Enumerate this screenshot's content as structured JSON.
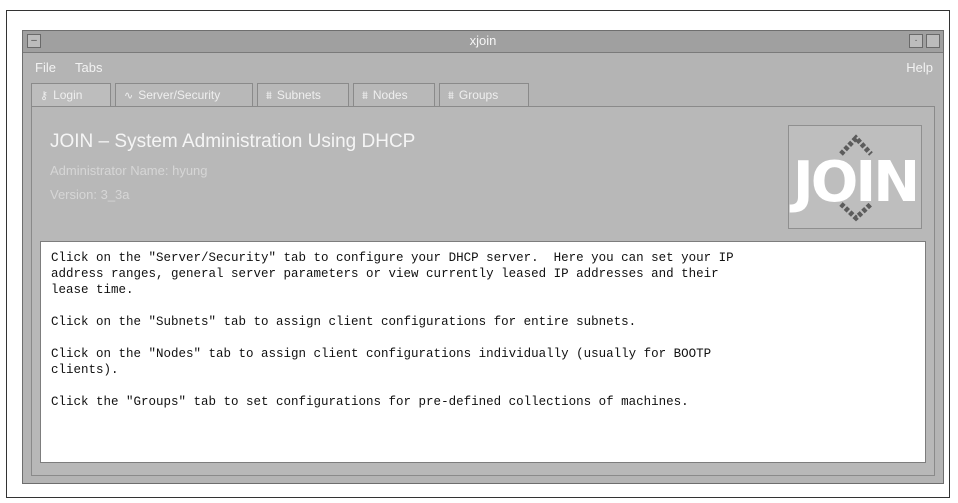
{
  "window": {
    "title": "xjoin"
  },
  "menubar": {
    "file": "File",
    "tabs": "Tabs",
    "help": "Help"
  },
  "tabs": [
    {
      "label": "Login",
      "icon": "keyhole-icon"
    },
    {
      "label": "Server/Security",
      "icon": "wave-icon"
    },
    {
      "label": "Subnets",
      "icon": "network-icon"
    },
    {
      "label": "Nodes",
      "icon": "network-icon"
    },
    {
      "label": "Groups",
      "icon": "network-icon"
    }
  ],
  "header": {
    "title": "JOIN – System Administration Using DHCP",
    "admin": "Administrator Name: hyung",
    "version": "Version: 3_3a"
  },
  "logo": {
    "text": "JOIN"
  },
  "body": {
    "para1": "Click on the \"Server/Security\" tab to configure your DHCP server.  Here you can set your IP\naddress ranges, general server parameters or view currently leased IP addresses and their\nlease time.",
    "para2": "Click on the \"Subnets\" tab to assign client configurations for entire subnets.",
    "para3": "Click on the \"Nodes\" tab to assign client configurations individually (usually for BOOTP\nclients).",
    "para4": "Click the \"Groups\" tab to set configurations for pre-defined collections of machines."
  }
}
